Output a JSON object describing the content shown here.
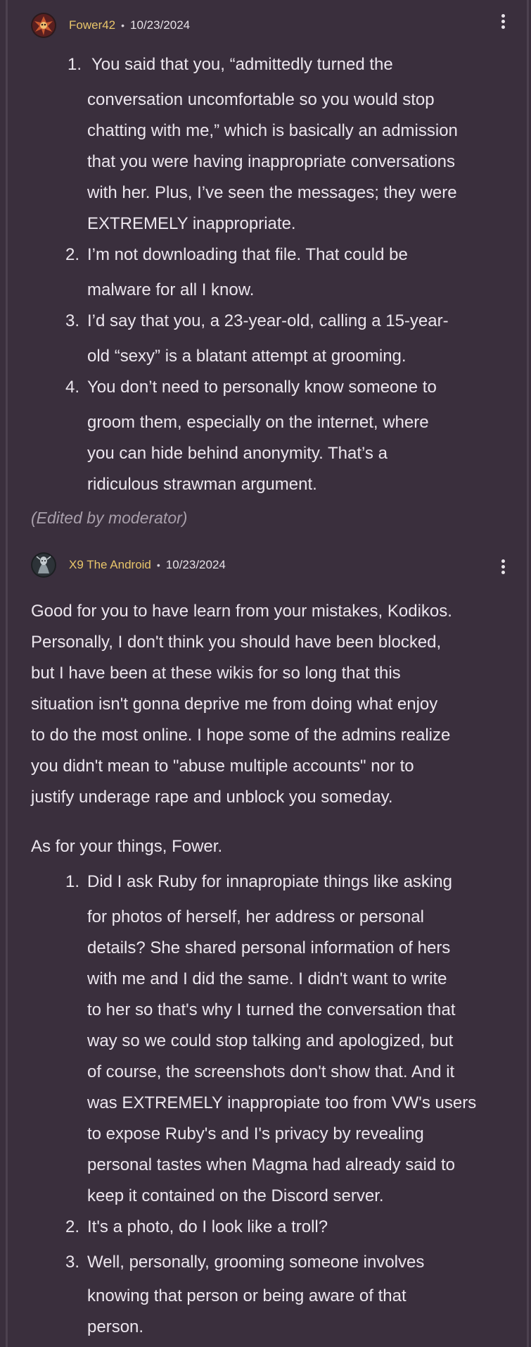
{
  "comments": [
    {
      "username": "Fower42",
      "separator": "•",
      "date": "10/23/2024",
      "items": [
        {
          "number": "1.",
          "lines": [
            "You said that you, “admittedly turned the",
            "conversation uncomfortable so you would stop",
            "chatting with me,” which is basically an admission",
            "that you were having inappropriate conversations",
            "with her. Plus, I’ve seen the messages; they were",
            "EXTREMELY inappropriate."
          ]
        },
        {
          "number": "2.",
          "lines": [
            "I’m not downloading that file. That could be",
            "malware for all I know."
          ]
        },
        {
          "number": "3.",
          "lines": [
            "I’d say that you, a 23-year-old, calling a 15-year-",
            "old “sexy” is a blatant attempt at grooming."
          ]
        },
        {
          "number": "4.",
          "lines": [
            "You don’t need to personally know someone to",
            "groom them, especially on the internet, where",
            "you can hide behind anonymity. That’s a",
            "ridiculous strawman argument."
          ]
        }
      ],
      "edited_note": "(Edited by moderator)"
    },
    {
      "username": "X9 The Android",
      "separator": "•",
      "date": "10/23/2024",
      "paragraph": [
        "Good for you to have learn from your mistakes, Kodikos.",
        "Personally, I don't think you should have been blocked,",
        "but I have been at these wikis for so long that this",
        "situation isn't gonna deprive me from doing what enjoy",
        "to do the most online. I hope some of the admins realize",
        "you didn't mean to \"abuse multiple accounts\" nor to",
        "justify underage rape and unblock you someday."
      ],
      "intro": "As for your things, Fower.",
      "items": [
        {
          "number": "1.",
          "lines": [
            "Did I ask Ruby for innapropiate things like asking",
            "for photos of herself, her address or personal",
            "details? She shared personal information of hers",
            "with me and I did the same. I didn't want to write",
            "to her so that's why I turned the conversation that",
            "way so we could stop talking and apologized, but",
            "of course, the screenshots don't show that. And it",
            "was EXTREMELY inappropiate too from VW's users",
            "to expose Ruby's and I's privacy by revealing",
            "personal tastes when Magma had already said to",
            "keep it contained on the Discord server."
          ]
        },
        {
          "number": "2.",
          "lines": [
            "It's a photo, do I look like a troll?"
          ]
        },
        {
          "number": "3.",
          "lines": [
            "Well, personally, grooming someone involves",
            "knowing that person or being aware of that",
            "person."
          ]
        }
      ]
    }
  ],
  "colors": {
    "background": "#3a2f3d",
    "username": "#e8c56a",
    "text": "#ece6ee",
    "edited": "#a89fab"
  },
  "icons": {
    "menu": "kebab-menu-icon"
  }
}
